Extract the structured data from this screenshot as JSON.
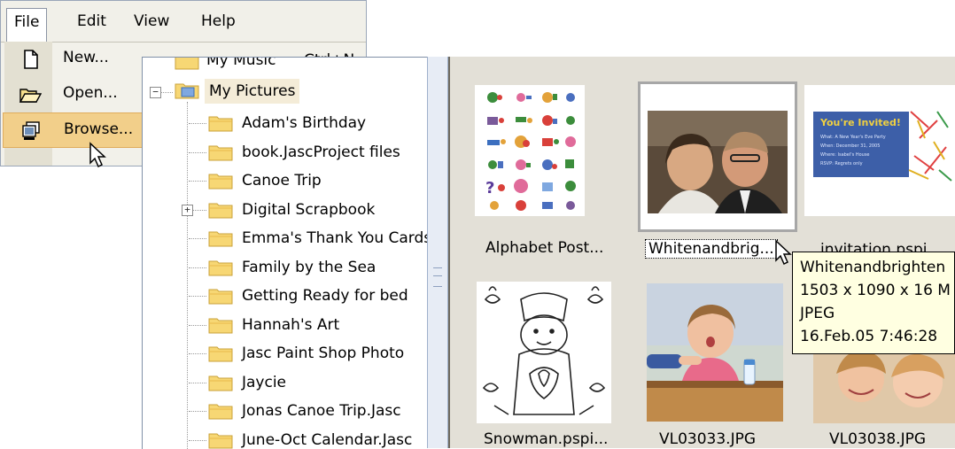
{
  "menubar": {
    "file": "File",
    "edit": "Edit",
    "view": "View",
    "help": "Help"
  },
  "file_menu": {
    "new_label": "New...",
    "new_shortcut": "Ctrl+N",
    "open_label": "Open...",
    "browse_label": "Browse..."
  },
  "tree": {
    "partial_top": "My Music",
    "root": "My Pictures",
    "items": [
      "Adam's Birthday",
      "book.JascProject files",
      "Canoe Trip",
      "Digital Scrapbook",
      "Emma's Thank You Cards",
      "Family by the Sea",
      "Getting Ready for bed",
      "Hannah's Art",
      "Jasc Paint Shop Photo",
      "Jaycie",
      "Jonas Canoe Trip.Jasc",
      "June-Oct Calendar.Jasc"
    ]
  },
  "gallery": {
    "thumbnails": [
      "Alphabet Post...",
      "Whitenandbrig...",
      "invitation.pspi...",
      "Snowman.pspi...",
      "VL03033.JPG",
      "VL03038.JPG"
    ],
    "invite_title": "You're Invited!",
    "invite_lines": [
      "What: A New Year's Eve Party",
      "When: December 31, 2005",
      "Where: Isabel's House",
      "RSVP: Regrets only"
    ]
  },
  "tooltip": {
    "filename": "Whitenandbrighten",
    "dimensions": "1503 x 1090 x 16 M",
    "format": "JPEG",
    "date": "16.Feb.05 7:46:28"
  },
  "colors": {
    "menu_highlight": "#f2cf8a",
    "tree_root_highlight": "#f4ecd8",
    "tooltip_bg": "#ffffe1",
    "gallery_bg": "#e3e0d7"
  }
}
